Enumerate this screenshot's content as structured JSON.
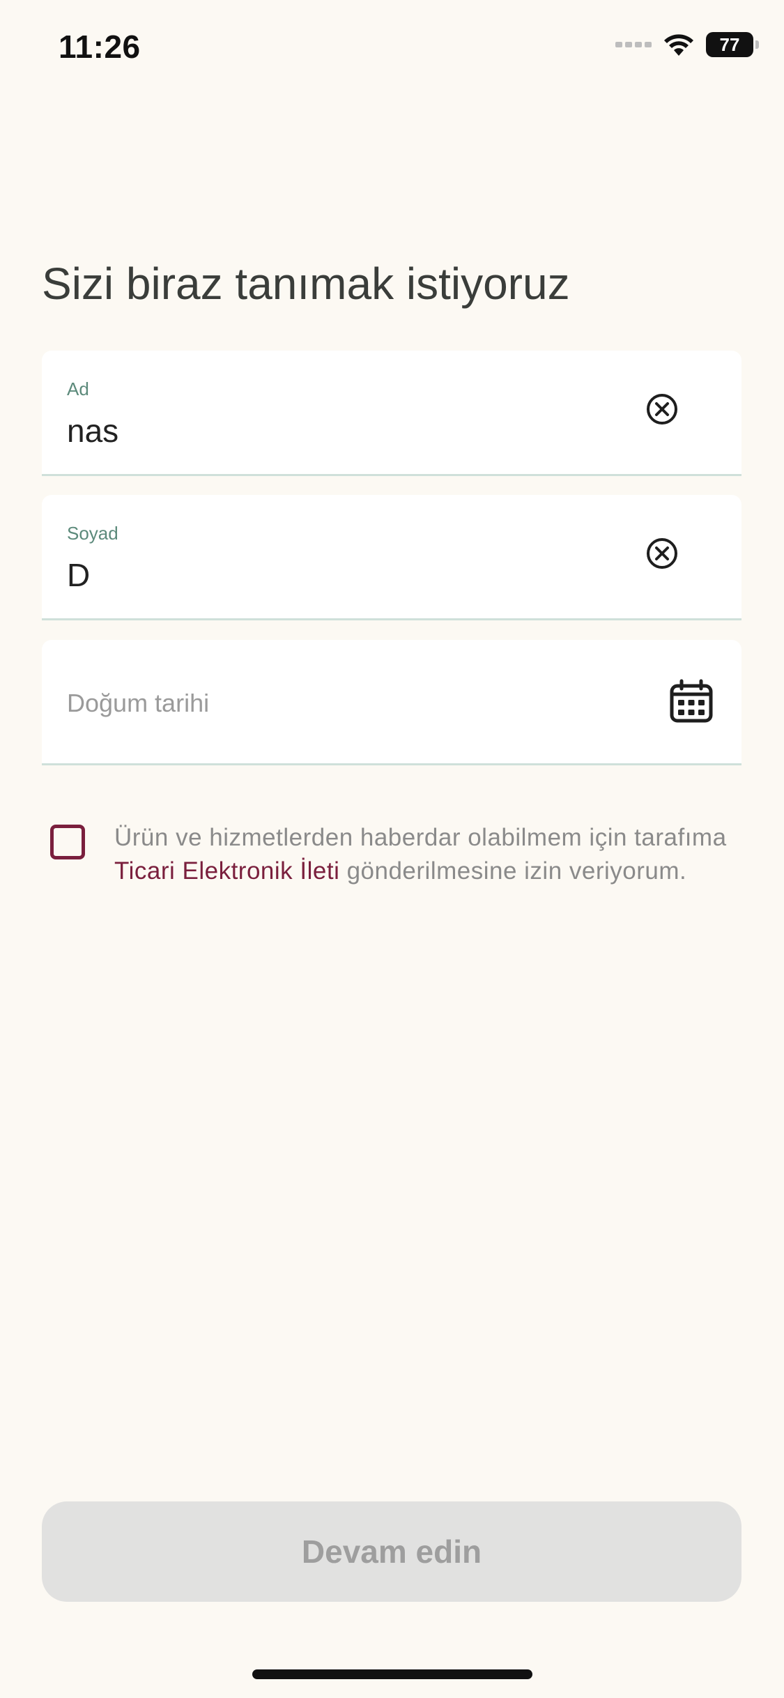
{
  "status_bar": {
    "time": "11:26",
    "battery": "77"
  },
  "page": {
    "title": "Sizi biraz tanımak istiyoruz"
  },
  "form": {
    "first_name": {
      "label": "Ad",
      "value": "nas"
    },
    "last_name": {
      "label": "Soyad",
      "value": "D"
    },
    "birth_date": {
      "placeholder": "Doğum tarihi"
    }
  },
  "consent": {
    "checked": false,
    "text_before": "Ürün ve hizmetlerden haberdar olabilmem için tarafıma ",
    "link_text": "Ticari Elektronik İleti",
    "text_after": " gönderilmesine izin veriyorum."
  },
  "actions": {
    "continue_label": "Devam edin"
  },
  "colors": {
    "background": "#FCF9F3",
    "accent": "#7A1F3D",
    "label_green": "#5C8A7B",
    "disabled_button": "#E1E1E0"
  },
  "icons": {
    "clear": "clear-circle-x-icon",
    "calendar": "calendar-icon",
    "wifi": "wifi-icon",
    "battery": "battery-icon",
    "signal": "cellular-signal-icon"
  }
}
